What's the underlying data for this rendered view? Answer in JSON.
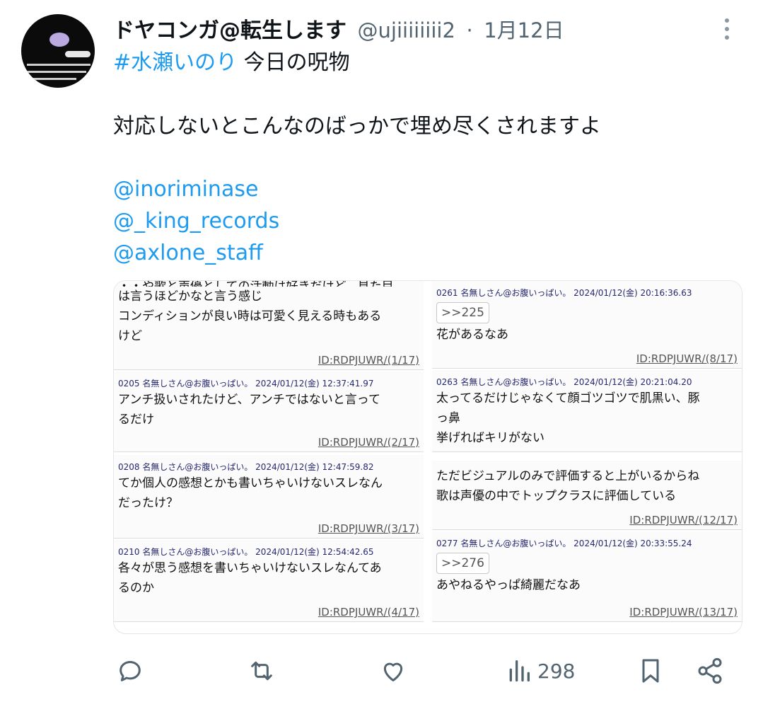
{
  "tweet": {
    "display_name": "ドヤコンガ@転生します",
    "handle": "@ujiiiiiiii2",
    "separator": "·",
    "date": "1月12日",
    "hashtag": "#水瀬いのり",
    "hashtag_suffix": " 今日の呪物",
    "line2": "対応しないとこんなのばっかで埋め尽くされますよ",
    "mentions": [
      "@inoriminase",
      "@_king_records",
      "@axlone_staff"
    ],
    "views": "298"
  },
  "media": {
    "left_posts": [
      {
        "meta": "",
        "lines": [
          "は言うほどかなと言う感じ",
          "コンディションが良い時は可愛く見える時もある",
          "けど"
        ],
        "id": "ID:RDPJUWR/(1/17)",
        "top_fragment": "・・や歌と声優としての活動は好きだけど、見た目"
      },
      {
        "meta": "0205 名無しさん@お腹いっぱい。 2024/01/12(金) 12:37:41.97",
        "lines": [
          "アンチ扱いされたけど、アンチではないと言って",
          "るだけ"
        ],
        "id": "ID:RDPJUWR/(2/17)"
      },
      {
        "meta": "0208 名無しさん@お腹いっぱい。 2024/01/12(金) 12:47:59.82",
        "lines": [
          "てか個人の感想とかも書いちゃいけないスレなん",
          "だったけ？"
        ],
        "id": "ID:RDPJUWR/(3/17)"
      },
      {
        "meta": "0210 名無しさん@お腹いっぱい。 2024/01/12(金) 12:54:42.65",
        "lines": [
          "各々が思う感想を書いちゃいけないスレなんてあ",
          "るのか"
        ],
        "id": "ID:RDPJUWR/(4/17)"
      }
    ],
    "right_posts": [
      {
        "meta": "0261 名無しさん@お腹いっぱい。 2024/01/12(金) 20:16:36.63",
        "quote": ">>225",
        "lines": [
          "花があるなあ"
        ],
        "id": "ID:RDPJUWR/(8/17)"
      },
      {
        "meta": "0263 名無しさん@お腹いっぱい。 2024/01/12(金) 20:21:04.20",
        "lines": [
          "太ってるだけじゃなくて顔ゴツゴツで肌黒い、豚",
          "っ鼻",
          "挙げればキリがない"
        ],
        "id": ""
      },
      {
        "meta": "",
        "lines": [
          "ただビジュアルのみで評価すると上がいるからね",
          "歌は声優の中でトップクラスに評価している"
        ],
        "id": "ID:RDPJUWR/(12/17)"
      },
      {
        "meta": "0277 名無しさん@お腹いっぱい。 2024/01/12(金) 20:33:55.24",
        "quote": ">>276",
        "lines": [
          "あやねるやっぱ綺麗だなあ"
        ],
        "id": "ID:RDPJUWR/(13/17)"
      }
    ]
  }
}
